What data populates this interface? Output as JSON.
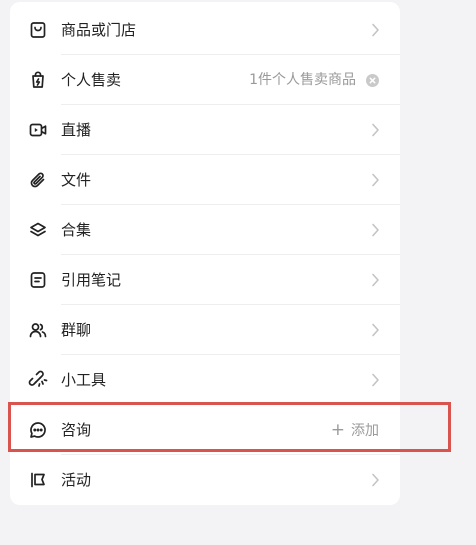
{
  "items": [
    {
      "label": "商品或门店",
      "icon": "store-bag-icon"
    },
    {
      "label": "个人售卖",
      "icon": "personal-bag-icon",
      "note": "1件个人售卖商品"
    },
    {
      "label": "直播",
      "icon": "live-camera-icon"
    },
    {
      "label": "文件",
      "icon": "paperclip-icon"
    },
    {
      "label": "合集",
      "icon": "layers-icon"
    },
    {
      "label": "引用笔记",
      "icon": "note-icon"
    },
    {
      "label": "群聊",
      "icon": "group-chat-icon"
    },
    {
      "label": "小工具",
      "icon": "link-tool-icon"
    },
    {
      "label": "咨询",
      "icon": "chat-bubble-icon",
      "action": "添加",
      "action_symbol": "+"
    },
    {
      "label": "活动",
      "icon": "flag-icon"
    }
  ],
  "colors": {
    "highlight_border": "#d9534f",
    "text_primary": "#222222",
    "text_secondary": "#9a9a9a"
  }
}
